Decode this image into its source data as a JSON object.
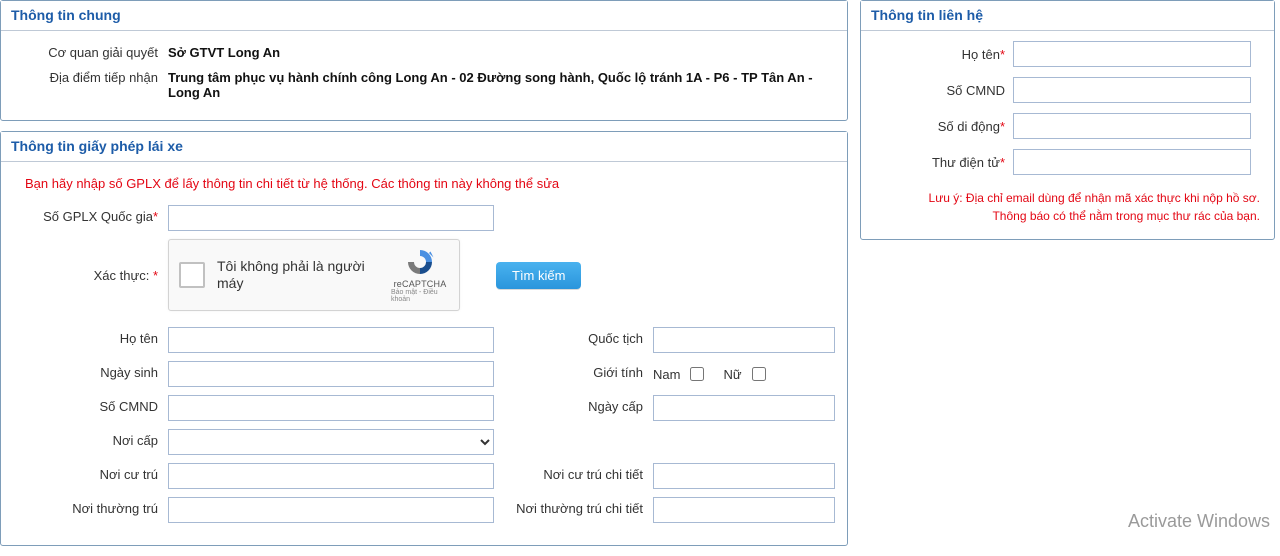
{
  "general": {
    "title": "Thông tin chung",
    "agency_label": "Cơ quan giải quyết",
    "agency_value": "Sở GTVT Long An",
    "location_label": "Địa điểm tiếp nhận",
    "location_value": "Trung tâm phục vụ hành chính công Long An - 02 Đường song hành, Quốc lộ tránh 1A - P6 - TP Tân An - Long An"
  },
  "license": {
    "title": "Thông tin giấy phép lái xe",
    "hint": "Bạn hãy nhập số GPLX để lấy thông tin chi tiết từ hệ thống. Các thông tin này không thể sửa",
    "gplx_label": "Số GPLX Quốc gia",
    "gplx_value": "",
    "captcha_label": "Xác thực:",
    "captcha_text": "Tôi không phải là người máy",
    "captcha_brand": "reCAPTCHA",
    "captcha_terms": "Bảo mật - Điều khoản",
    "search_btn": "Tìm kiếm",
    "fields": {
      "hoten_label": "Họ tên",
      "hoten_value": "",
      "quoctich_label": "Quốc tịch",
      "quoctich_value": "",
      "ngaysinh_label": "Ngày sinh",
      "ngaysinh_value": "",
      "gioitinh_label": "Giới tính",
      "gioitinh_nam": "Nam",
      "gioitinh_nu": "Nữ",
      "cmnd_label": "Số CMND",
      "cmnd_value": "",
      "ngaycap_label": "Ngày cấp",
      "ngaycap_value": "",
      "noicap_label": "Nơi cấp",
      "noicap_value": "",
      "noicutru_label": "Nơi cư trú",
      "noicutru_value": "",
      "noicutruchitiet_label": "Nơi cư trú chi tiết",
      "noicutruchitiet_value": "",
      "noithuongtru_label": "Nơi thường trú",
      "noithuongtru_value": "",
      "noithuongtruchitiet_label": "Nơi thường trú chi tiết",
      "noithuongtruchitiet_value": ""
    }
  },
  "contact": {
    "title": "Thông tin liên hệ",
    "hoten_label": "Họ tên",
    "hoten_value": "",
    "cmnd_label": "Số CMND",
    "cmnd_value": "",
    "didong_label": "Số di động",
    "didong_value": "",
    "email_label": "Thư điện tử",
    "email_value": "",
    "note": "Lưu ý: Địa chỉ email dùng để nhận mã xác thực khi nộp hồ sơ. Thông báo có thể nằm trong mục thư rác của bạn."
  },
  "watermark": {
    "line1": "Activate Windows"
  }
}
